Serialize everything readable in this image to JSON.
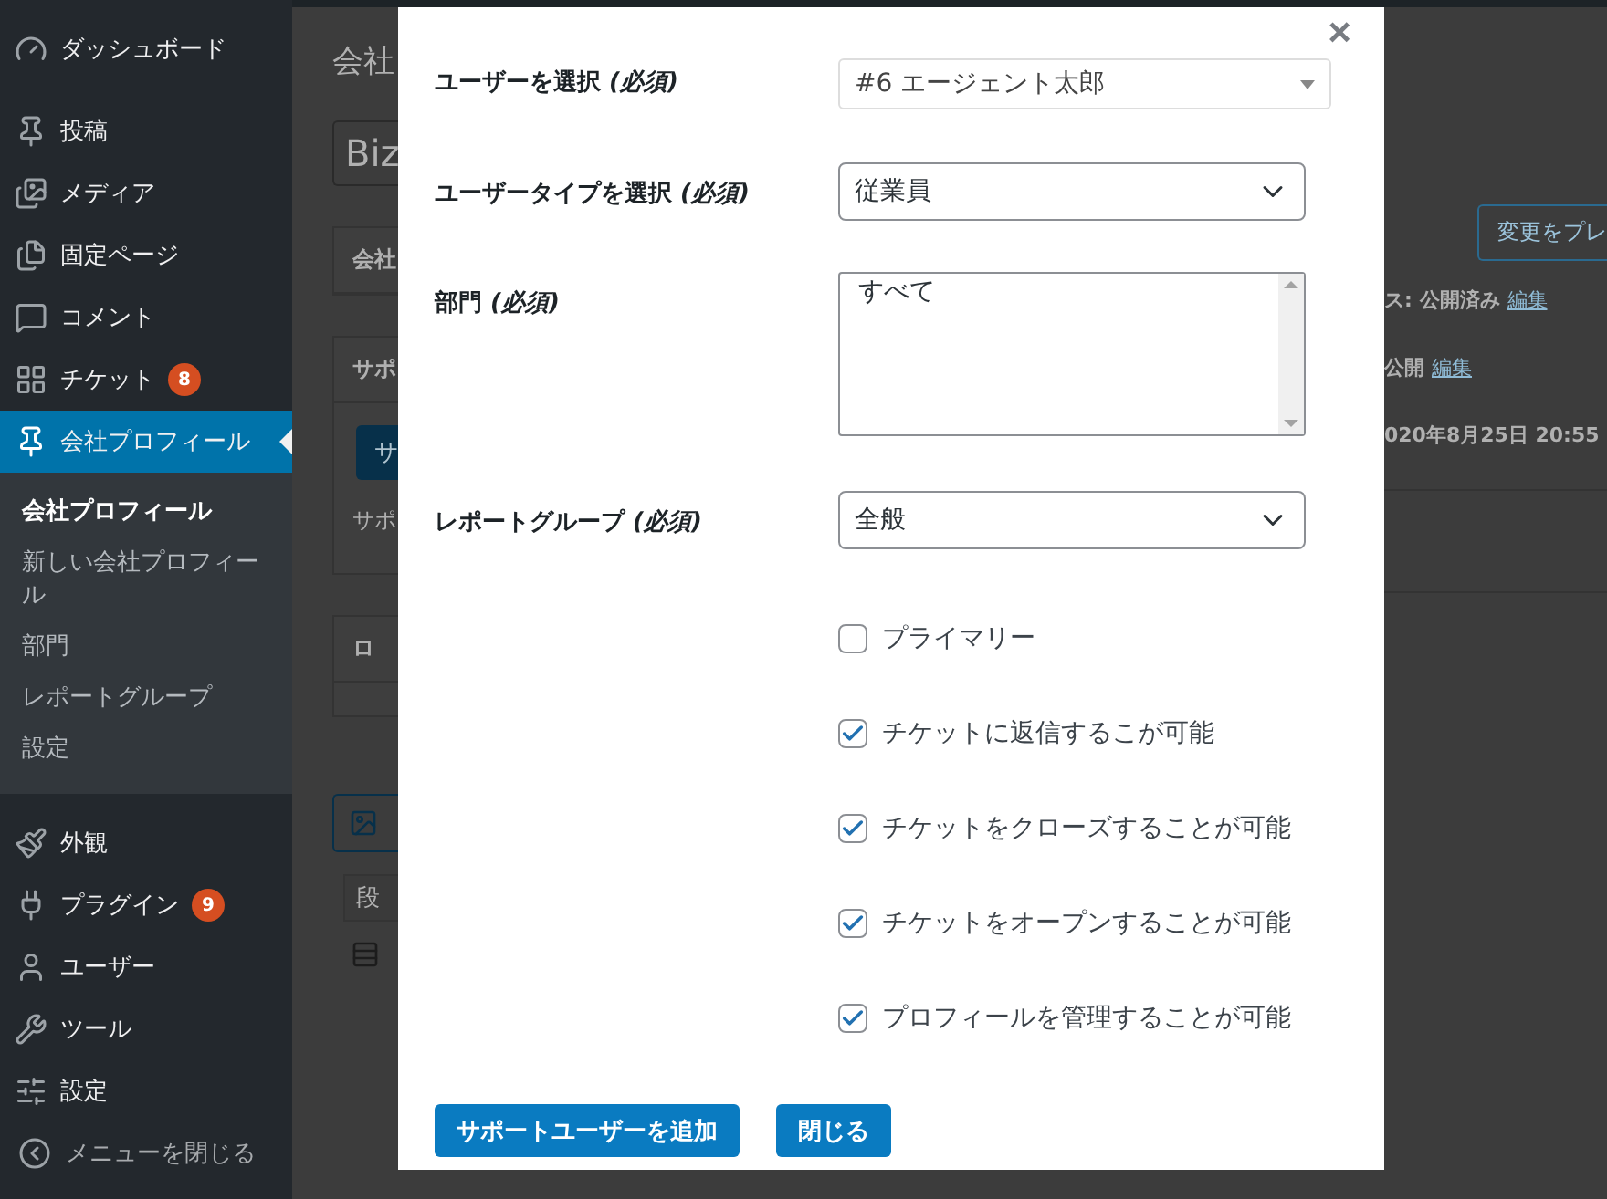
{
  "sidebar": {
    "items": [
      {
        "label": "ダッシュボード",
        "selected": false
      },
      {
        "label": "投稿",
        "selected": false
      },
      {
        "label": "メディア",
        "selected": false
      },
      {
        "label": "固定ページ",
        "selected": false
      },
      {
        "label": "コメント",
        "selected": false
      },
      {
        "label": "チケット",
        "selected": false,
        "badge": "8"
      },
      {
        "label": "会社プロフィール",
        "selected": true,
        "children": [
          {
            "label": "会社プロフィール",
            "selected": true
          },
          {
            "label": "新しい会社プロフィール",
            "selected": false
          },
          {
            "label": "部門",
            "selected": false
          },
          {
            "label": "レポートグループ",
            "selected": false
          },
          {
            "label": "設定",
            "selected": false
          }
        ]
      },
      {
        "label": "外観",
        "selected": false
      },
      {
        "label": "プラグイン",
        "selected": false,
        "badge": "9"
      },
      {
        "label": "ユーザー",
        "selected": false
      },
      {
        "label": "ツール",
        "selected": false
      },
      {
        "label": "設定",
        "selected": false
      }
    ],
    "collapse": "メニューを閉じる"
  },
  "background": {
    "page_heading": "会社",
    "title_value": "Biz",
    "panel_1_header": "会社",
    "panel_2_header": "サポ",
    "panel_2_button": "サ",
    "panel_2_text": "サポ",
    "panel_3_header": "ロ",
    "block_label": "段",
    "preview_button": "変更をプレ",
    "status_label": "ス:",
    "status_value": "公開済み",
    "status_link": "編集",
    "visibility_value": "公開",
    "visibility_link": "編集",
    "published_date": "020年8月25日 20:55"
  },
  "modal": {
    "close": "×",
    "fields": [
      {
        "kind": "select2",
        "label": "ユーザーを選択 *(必須)*",
        "value": "#6 エージェント太郎"
      },
      {
        "kind": "select",
        "label": "ユーザータイプを選択 *(必須)*",
        "value": "従業員"
      },
      {
        "kind": "listbox",
        "label": "部門 *(必須)*",
        "options": [
          "すべて"
        ]
      },
      {
        "kind": "select",
        "label": "レポートグループ *(必須)*",
        "value": "全般"
      }
    ],
    "checkboxes": [
      {
        "label": "プライマリー",
        "checked": false
      },
      {
        "label": "チケットに返信するこが可能",
        "checked": true
      },
      {
        "label": "チケットをクローズすることが可能",
        "checked": true
      },
      {
        "label": "チケットをオープンすることが可能",
        "checked": true
      },
      {
        "label": "プロフィールを管理することが可能",
        "checked": true
      }
    ],
    "buttons": [
      "サポートユーザーを追加",
      "閉じる"
    ]
  }
}
